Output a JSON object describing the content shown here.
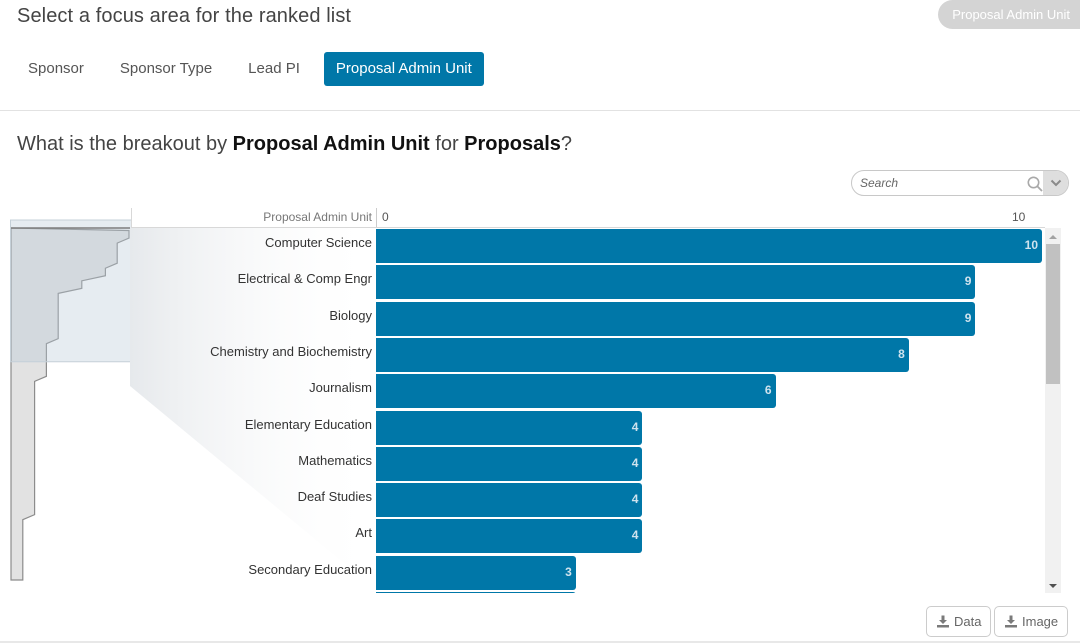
{
  "header": {
    "focus_title": "Select a focus area for the ranked list",
    "current_focus_pill": "Proposal Admin Unit",
    "tabs": [
      {
        "label": "Sponsor",
        "active": false
      },
      {
        "label": "Sponsor Type",
        "active": false
      },
      {
        "label": "Lead PI",
        "active": false
      },
      {
        "label": "Proposal Admin Unit",
        "active": true
      }
    ]
  },
  "question": {
    "prefix": "What is the breakout by ",
    "dimension": "Proposal Admin Unit",
    "middle": " for ",
    "measure": "Proposals",
    "suffix": "?"
  },
  "search": {
    "placeholder": "Search",
    "value": ""
  },
  "icons": {
    "search": "search-icon",
    "dropdown": "chevron-down-icon",
    "download": "download-icon",
    "scroll_up": "scroll-up-arrow-icon",
    "scroll_down": "scroll-down-arrow-icon"
  },
  "buttons": {
    "data_label": "Data",
    "image_label": "Image"
  },
  "colors": {
    "accent": "#0077a8",
    "bar": "#0077a8",
    "bar_value_text": "#cfe3ee",
    "pill_bg": "#d4d4d4"
  },
  "chart_data": {
    "type": "bar",
    "orientation": "horizontal",
    "title": "What is the breakout by Proposal Admin Unit for Proposals?",
    "ylabel": "Proposal Admin Unit",
    "xlabel": "",
    "xlim": [
      0,
      10
    ],
    "x_ticks": [
      "0",
      "10"
    ],
    "categories": [
      "Computer Science",
      "Electrical & Comp Engr",
      "Biology",
      "Chemistry and Biochemistry",
      "Journalism",
      "Elementary Education",
      "Mathematics",
      "Deaf Studies",
      "Art",
      "Secondary Education"
    ],
    "values": [
      10,
      9,
      9,
      8,
      6,
      4,
      4,
      4,
      4,
      3
    ],
    "data_labels": true,
    "grid": false,
    "legend": "none",
    "scroll": {
      "visible_fraction": 0.38,
      "position": 0
    },
    "overview_profile": [
      10,
      9,
      9,
      8,
      6,
      4,
      4,
      4,
      4,
      3,
      3,
      3,
      2,
      2,
      2,
      2,
      2,
      2,
      2,
      2,
      2,
      2,
      2,
      1,
      1,
      1,
      1,
      1
    ]
  }
}
